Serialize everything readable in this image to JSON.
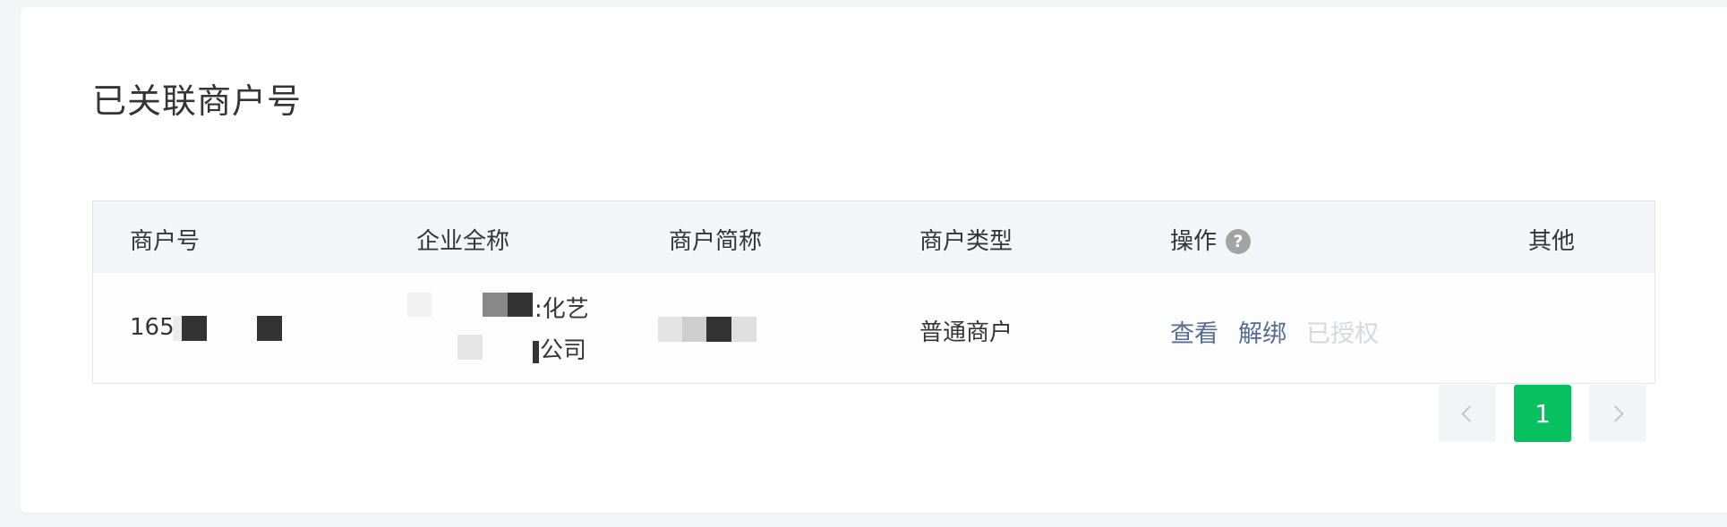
{
  "page": {
    "title": "已关联商户号"
  },
  "table": {
    "headers": {
      "merchant_id": "商户号",
      "company_name": "企业全称",
      "short_name": "商户简称",
      "merchant_type": "商户类型",
      "actions": "操作",
      "other": "其他"
    },
    "rows": [
      {
        "merchant_id_prefix": "165",
        "company_name_line1_tail": ":化艺",
        "company_name_line2_tail": "公司",
        "merchant_type": "普通商户",
        "actions": {
          "view": "查看",
          "unbind": "解绑",
          "authorized": "已授权"
        },
        "other": ""
      }
    ]
  },
  "icons": {
    "help": "question-circle-icon",
    "prev": "chevron-left-icon",
    "next": "chevron-right-icon"
  },
  "help_icon_glyph": "?",
  "pagination": {
    "current": "1"
  },
  "colors": {
    "accent": "#07c160",
    "link": "#576b95",
    "disabled": "#d6d8dc"
  }
}
